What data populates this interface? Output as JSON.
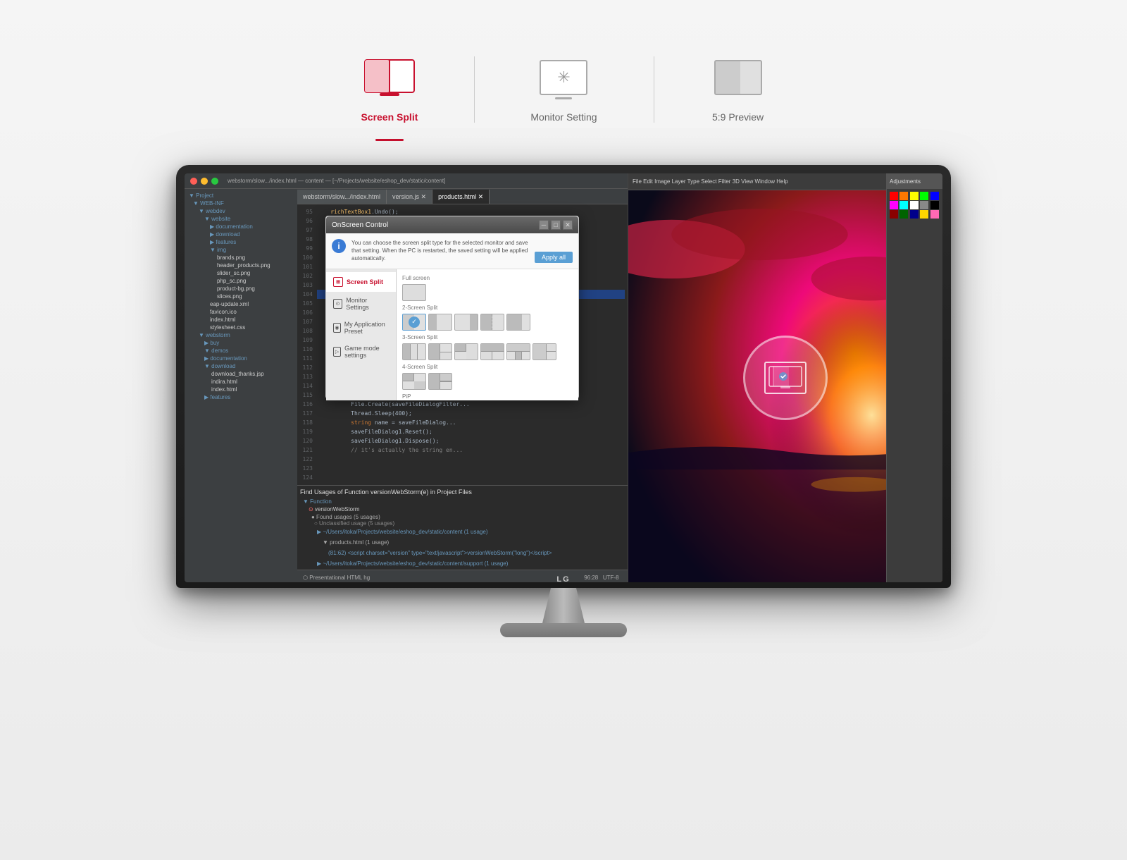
{
  "page": {
    "background_color": "#f0f0f0"
  },
  "tabs": [
    {
      "id": "screen-split",
      "label": "Screen Split",
      "active": true,
      "icon": "screen-split-icon"
    },
    {
      "id": "monitor-setting",
      "label": "Monitor Setting",
      "active": false,
      "icon": "monitor-setting-icon"
    },
    {
      "id": "preview",
      "label": "5:9 Preview",
      "active": false,
      "icon": "preview-icon"
    }
  ],
  "dialog": {
    "title": "OnScreen Control",
    "info_text": "You can choose the screen split type for the selected monitor and save that setting. When the PC is restarted, the saved setting will be applied automatically.",
    "apply_button": "Apply all",
    "menu_items": [
      {
        "label": "Screen Split",
        "active": true
      },
      {
        "label": "Monitor Settings",
        "active": false
      },
      {
        "label": "My Application Preset",
        "active": false
      },
      {
        "label": "Game mode settings",
        "active": false
      }
    ],
    "screen_options": {
      "full_screen": "Full screen",
      "split_2": "2-Screen Split",
      "split_3": "3-Screen Split",
      "split_4": "4-Screen Split",
      "pip": "PiP"
    }
  },
  "monitor": {
    "brand": "LG"
  },
  "ide": {
    "filename": "index.html",
    "tabs": [
      "webstorm/slow.../index.html",
      "version.js",
      "products.html"
    ],
    "active_tab": "products.html"
  }
}
